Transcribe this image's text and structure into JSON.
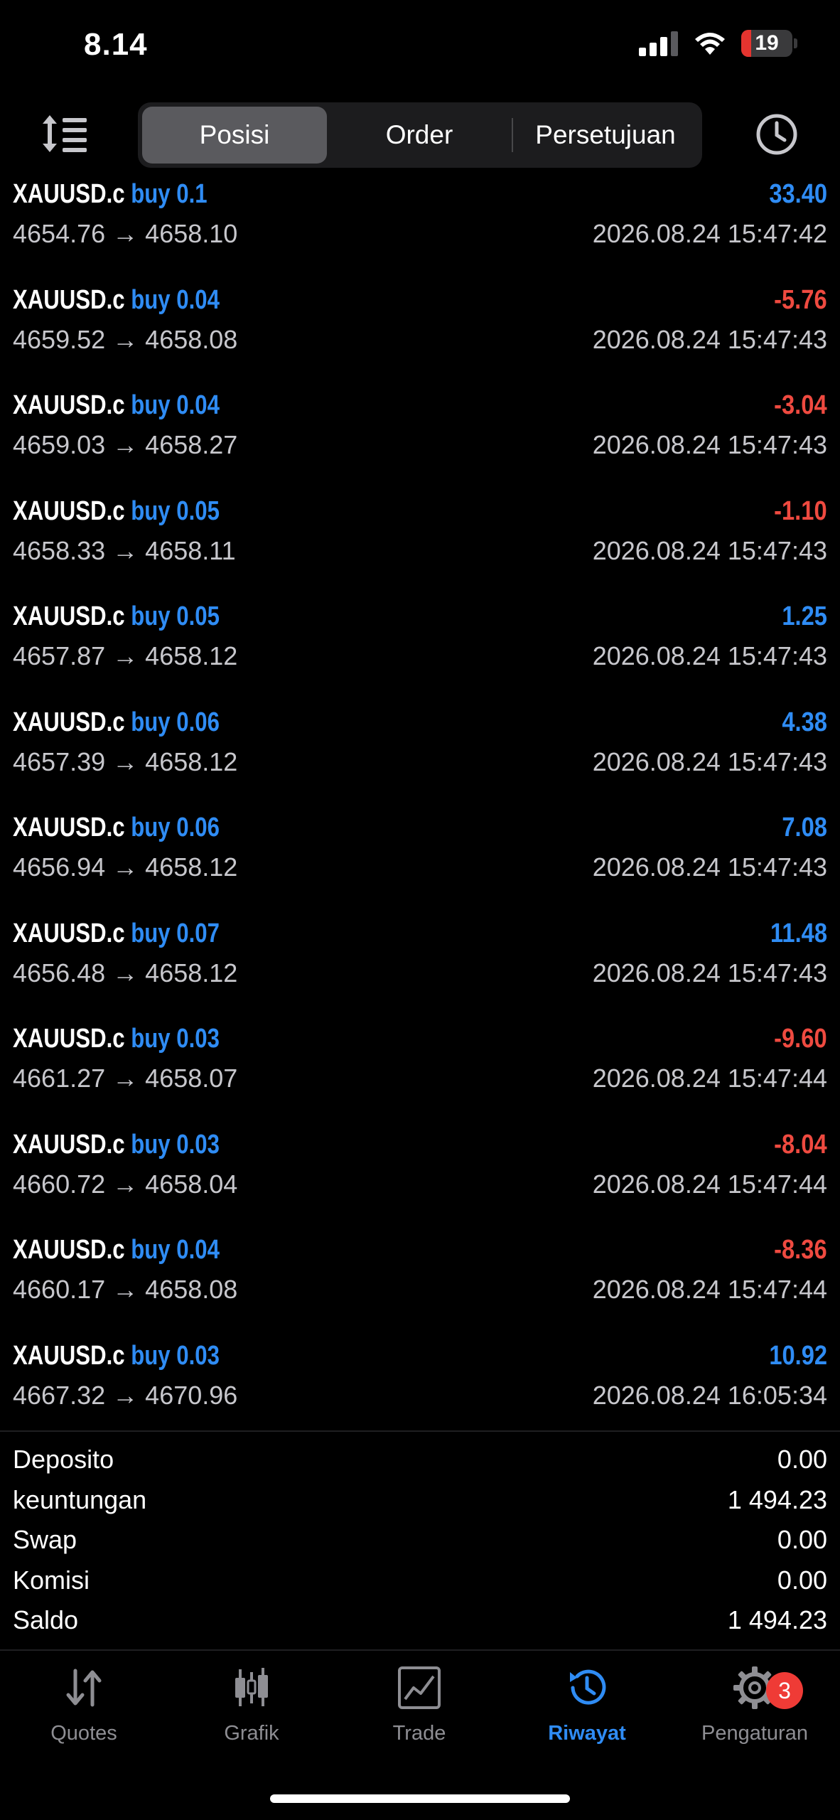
{
  "status": {
    "time": "8.14",
    "battery": "19"
  },
  "segments": [
    {
      "label": "Posisi",
      "active": true
    },
    {
      "label": "Order",
      "active": false
    },
    {
      "label": "Persetujuan",
      "active": false
    }
  ],
  "deals": [
    {
      "symbol": "XAUUSD.c",
      "side": "buy 0.1",
      "profit": "33.40",
      "open": "4654.76",
      "close": "4658.10",
      "time": "2026.08.24 15:47:42"
    },
    {
      "symbol": "XAUUSD.c",
      "side": "buy 0.04",
      "profit": "-5.76",
      "open": "4659.52",
      "close": "4658.08",
      "time": "2026.08.24 15:47:43"
    },
    {
      "symbol": "XAUUSD.c",
      "side": "buy 0.04",
      "profit": "-3.04",
      "open": "4659.03",
      "close": "4658.27",
      "time": "2026.08.24 15:47:43"
    },
    {
      "symbol": "XAUUSD.c",
      "side": "buy 0.05",
      "profit": "-1.10",
      "open": "4658.33",
      "close": "4658.11",
      "time": "2026.08.24 15:47:43"
    },
    {
      "symbol": "XAUUSD.c",
      "side": "buy 0.05",
      "profit": "1.25",
      "open": "4657.87",
      "close": "4658.12",
      "time": "2026.08.24 15:47:43"
    },
    {
      "symbol": "XAUUSD.c",
      "side": "buy 0.06",
      "profit": "4.38",
      "open": "4657.39",
      "close": "4658.12",
      "time": "2026.08.24 15:47:43"
    },
    {
      "symbol": "XAUUSD.c",
      "side": "buy 0.06",
      "profit": "7.08",
      "open": "4656.94",
      "close": "4658.12",
      "time": "2026.08.24 15:47:43"
    },
    {
      "symbol": "XAUUSD.c",
      "side": "buy 0.07",
      "profit": "11.48",
      "open": "4656.48",
      "close": "4658.12",
      "time": "2026.08.24 15:47:43"
    },
    {
      "symbol": "XAUUSD.c",
      "side": "buy 0.03",
      "profit": "-9.60",
      "open": "4661.27",
      "close": "4658.07",
      "time": "2026.08.24 15:47:44"
    },
    {
      "symbol": "XAUUSD.c",
      "side": "buy 0.03",
      "profit": "-8.04",
      "open": "4660.72",
      "close": "4658.04",
      "time": "2026.08.24 15:47:44"
    },
    {
      "symbol": "XAUUSD.c",
      "side": "buy 0.04",
      "profit": "-8.36",
      "open": "4660.17",
      "close": "4658.08",
      "time": "2026.08.24 15:47:44"
    },
    {
      "symbol": "XAUUSD.c",
      "side": "buy 0.03",
      "profit": "10.92",
      "open": "4667.32",
      "close": "4670.96",
      "time": "2026.08.24 16:05:34"
    }
  ],
  "summary": [
    {
      "label": "Deposito",
      "value": "0.00"
    },
    {
      "label": "keuntungan",
      "value": "1 494.23"
    },
    {
      "label": "Swap",
      "value": "0.00"
    },
    {
      "label": "Komisi",
      "value": "0.00"
    },
    {
      "label": "Saldo",
      "value": "1 494.23"
    }
  ],
  "tabs": [
    {
      "label": "Quotes",
      "icon": "quotes-arrows-icon",
      "active": false
    },
    {
      "label": "Grafik",
      "icon": "candlestick-icon",
      "active": false
    },
    {
      "label": "Trade",
      "icon": "trade-chart-icon",
      "active": false
    },
    {
      "label": "Riwayat",
      "icon": "history-icon",
      "active": true
    },
    {
      "label": "Pengaturan",
      "icon": "gear-icon",
      "active": false,
      "badge": "3"
    }
  ],
  "colors": {
    "positive": "#2f8cf4",
    "negative": "#ef4a40",
    "accent": "#2f8cf4",
    "badge": "#ef3b36"
  },
  "arrow": "→"
}
